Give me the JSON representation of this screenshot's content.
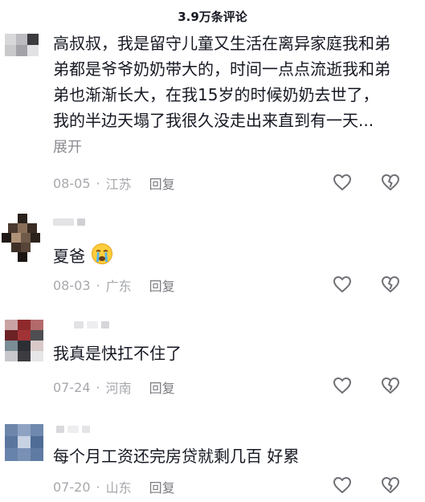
{
  "header": {
    "title": "3.9万条评论"
  },
  "comments": [
    {
      "text": "高叔叔，我是留守儿童又生活在离异家庭我和弟弟都是爷爷奶奶带大的，时间一点点流逝我和弟弟也渐渐长大，在我15岁的时候奶奶去世了，我的半边天塌了我很久没走出来直到有一天...",
      "expand": "展开",
      "date": "08-05",
      "location": "江苏",
      "reply": "回复"
    },
    {
      "text": "夏爸",
      "emoji": "crying-face-icon",
      "date": "08-03",
      "location": "广东",
      "reply": "回复"
    },
    {
      "text": "我真是快扛不住了",
      "date": "07-24",
      "location": "河南",
      "reply": "回复"
    },
    {
      "text": "每个月工资还完房贷就剩几百  好累",
      "date": "07-20",
      "location": "山东",
      "reply": "回复"
    }
  ],
  "icons": {
    "like": "heart-outline-icon",
    "dislike": "broken-heart-outline-icon"
  },
  "colors": {
    "text": "#161823",
    "meta": "#a7a8ad",
    "icon": "#6f7075"
  }
}
